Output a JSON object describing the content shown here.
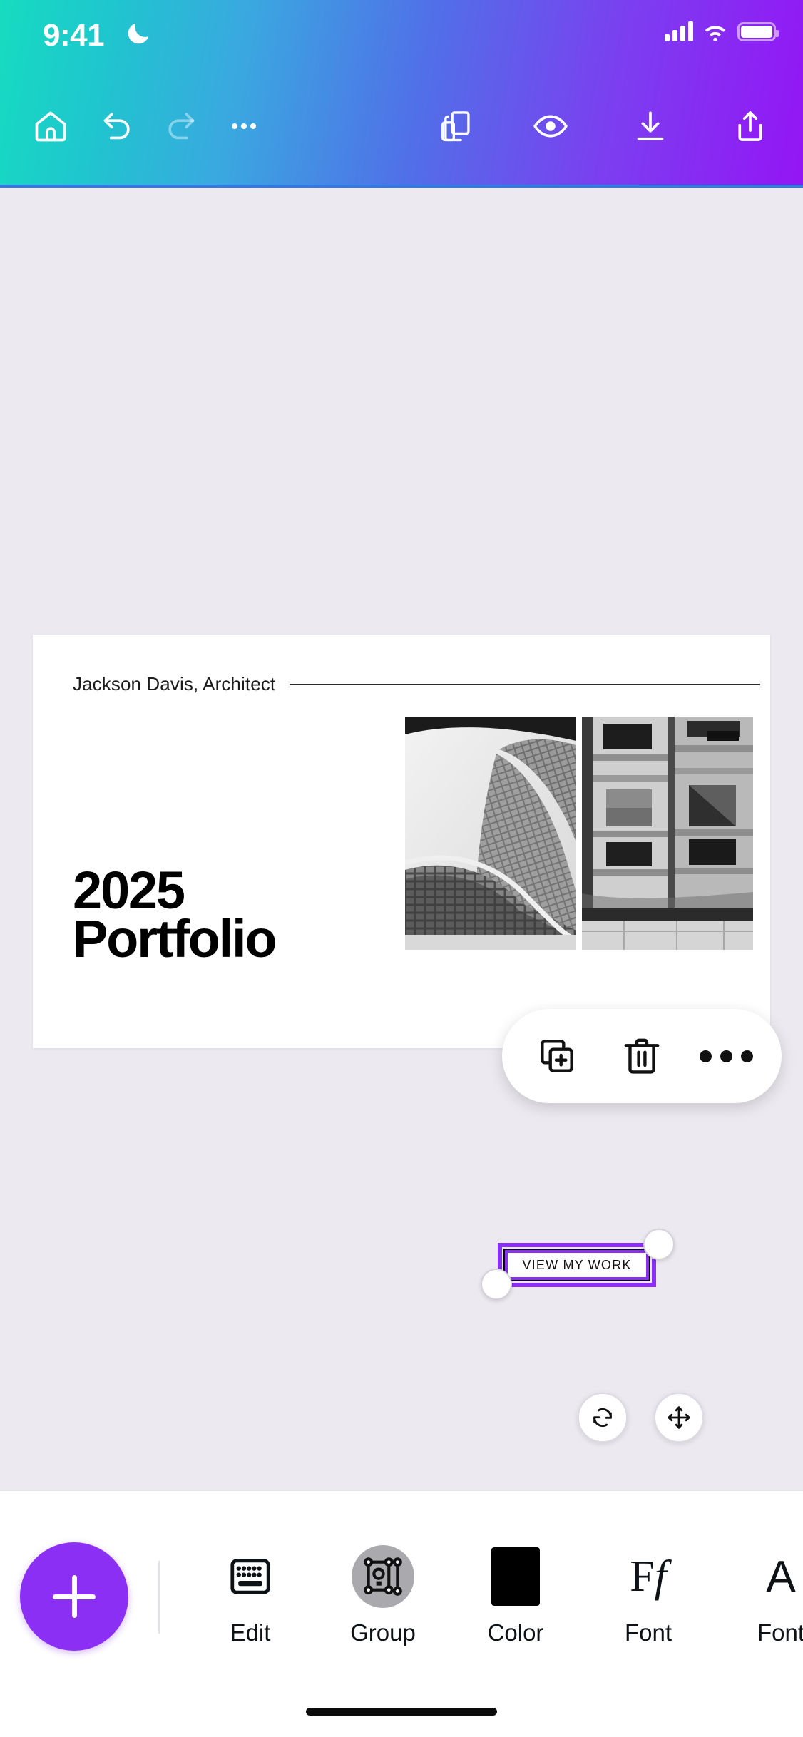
{
  "status_bar": {
    "time": "9:41",
    "dnd_icon": "moon-icon",
    "signal_icon": "cellular-signal-icon",
    "wifi_icon": "wifi-icon",
    "battery_icon": "battery-icon"
  },
  "top_toolbar": {
    "gradient_start": "#16dcc0",
    "gradient_end": "#9415f5",
    "items": [
      {
        "name": "home",
        "icon": "home-icon",
        "label": "Home",
        "state": "enabled"
      },
      {
        "name": "undo",
        "icon": "undo-icon",
        "label": "Undo",
        "state": "enabled"
      },
      {
        "name": "redo",
        "icon": "redo-icon",
        "label": "Redo",
        "state": "disabled"
      },
      {
        "name": "more",
        "icon": "more-horizontal-icon",
        "label": "More",
        "state": "enabled"
      },
      {
        "name": "pages",
        "icon": "pages-icon",
        "label": "Pages",
        "state": "enabled"
      },
      {
        "name": "preview",
        "icon": "eye-icon",
        "label": "Preview",
        "state": "enabled"
      },
      {
        "name": "download",
        "icon": "download-icon",
        "label": "Download",
        "state": "enabled"
      },
      {
        "name": "share",
        "icon": "share-icon",
        "label": "Share",
        "state": "enabled"
      }
    ]
  },
  "canvas": {
    "background_color": "#eceaf0",
    "design": {
      "background_color": "#ffffff",
      "byline": "Jackson Davis, Architect",
      "title_line_1": "2025",
      "title_line_2": "Portfolio",
      "photos": [
        {
          "name": "photo-curved-facade",
          "alt": "black and white curved modern building facade"
        },
        {
          "name": "photo-building-windows",
          "alt": "black and white building windows and pavement"
        }
      ],
      "cta_button": {
        "label": "VIEW MY WORK",
        "selected": true,
        "selection_color": "#8b2ff5"
      }
    }
  },
  "context_menu": {
    "items": [
      {
        "name": "duplicate",
        "icon": "duplicate-icon",
        "label": "Duplicate"
      },
      {
        "name": "delete",
        "icon": "trash-icon",
        "label": "Delete"
      },
      {
        "name": "more",
        "icon": "more-horizontal-icon",
        "label": "More"
      }
    ]
  },
  "transform_controls": [
    {
      "name": "rotate",
      "icon": "rotate-icon",
      "label": "Rotate"
    },
    {
      "name": "move",
      "icon": "move-arrows-icon",
      "label": "Move"
    }
  ],
  "bottom_toolbar": {
    "add_button": {
      "icon": "plus-icon",
      "label": "Add",
      "color": "#8b2ff5"
    },
    "items": [
      {
        "name": "edit",
        "icon": "keyboard-icon",
        "label": "Edit"
      },
      {
        "name": "group",
        "icon": "group-select-icon",
        "label": "Group"
      },
      {
        "name": "color",
        "icon": "color-swatch-icon",
        "label": "Color",
        "swatch": "#000000"
      },
      {
        "name": "font",
        "icon": "font-ff-icon",
        "label": "Font"
      },
      {
        "name": "font-size",
        "icon": "font-size-a-icon",
        "label": "Font"
      }
    ]
  },
  "home_indicator": {
    "name": "home-indicator"
  }
}
